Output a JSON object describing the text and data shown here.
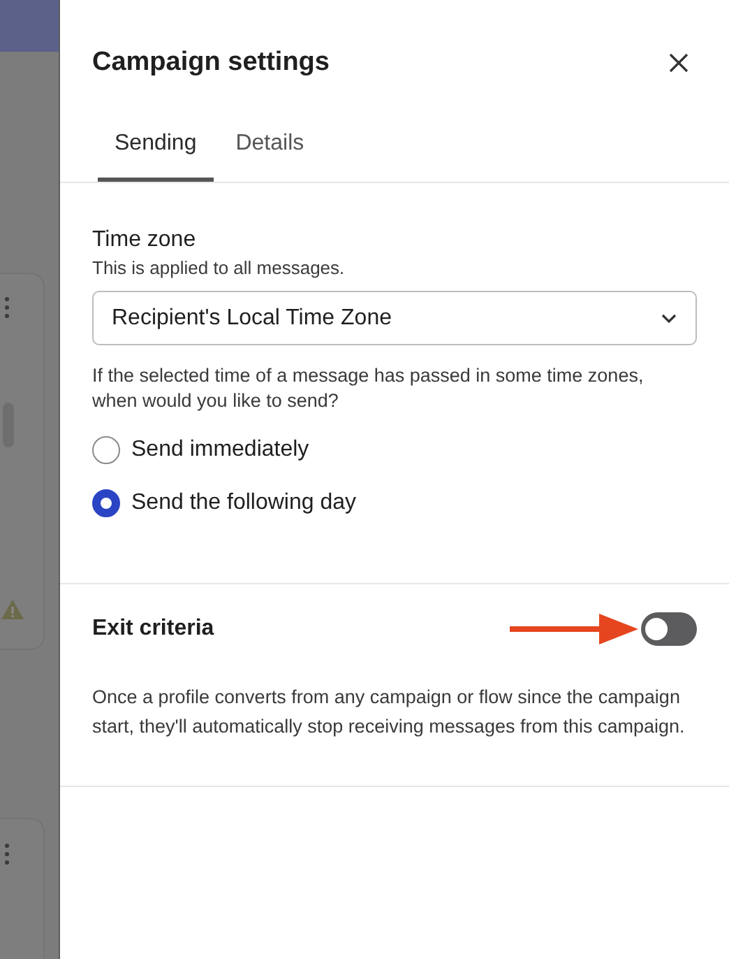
{
  "panel": {
    "title": "Campaign settings"
  },
  "tabs": [
    {
      "label": "Sending",
      "selected": true
    },
    {
      "label": "Details",
      "selected": false
    }
  ],
  "time_zone": {
    "label": "Time zone",
    "hint": "This is applied to all messages.",
    "value": "Recipient's Local Time Zone"
  },
  "send_question": "If the selected time of a message has passed in some time zones, when would you like to send?",
  "send_options": [
    {
      "label": "Send immediately",
      "selected": false
    },
    {
      "label": "Send the following day",
      "selected": true
    }
  ],
  "exit_criteria": {
    "label": "Exit criteria",
    "on": false,
    "description": "Once a profile converts from any campaign or flow since the campaign start, they'll automatically stop receiving messages from this campaign."
  }
}
